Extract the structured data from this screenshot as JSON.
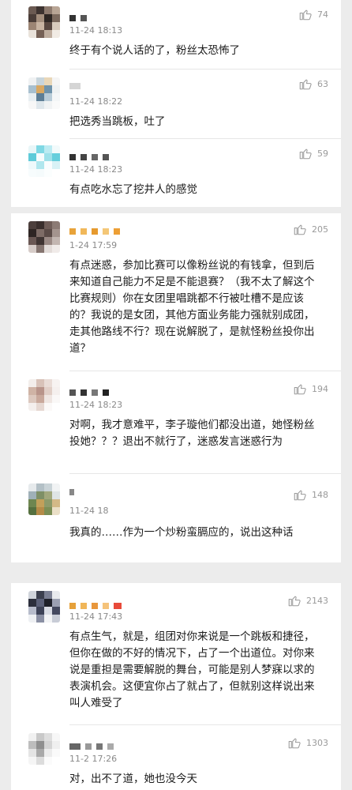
{
  "comments": [
    {
      "time": "11-24 18:13",
      "likes": "74",
      "text": "终于有个说人话的了，粉丝太恐怖了"
    },
    {
      "time": "11-24 18:22",
      "likes": "63",
      "text": "把选秀当跳板，吐了"
    },
    {
      "time": "11-24 18:23",
      "likes": "59",
      "text": "有点吃水忘了挖井人的感觉"
    },
    {
      "time": "1-24 17:59",
      "likes": "205",
      "text": "有点迷惑，参加比赛可以像粉丝说的有钱拿，但到后来知道自己能力不足是不能退赛？（我不太了解这个比赛规则）你在女团里唱跳都不行被吐槽不是应该的？我说的是女团，其他方面业务能力强就别成团，走其他路线不行？现在说解脱了，是就怪粉丝投你出道？"
    },
    {
      "time": "11-24 18:23",
      "likes": "194",
      "text": "对啊，我才意难平，李子璇他们都没出道，她怪粉丝投她？？？退出不就行了，迷惑发言迷惑行为"
    },
    {
      "time": "11-24 18",
      "likes": "148",
      "text": "我真的……作为一个炒粉蛮膈应的，说出这种话"
    },
    {
      "time": "11-24 17:43",
      "likes": "2143",
      "text": "有点生气，就是，组团对你来说是一个跳板和捷径，但你在做的不好的情况下，占了一个出道位。对你来说是重担是需要解脱的舞台，可能是别人梦寐以求的表演机会。这便宜你占了就占了，但就别这样说出来叫人难受了"
    },
    {
      "time": "11-2 17:26",
      "likes": "1303",
      "text": "对，出不了道，她也没今天"
    }
  ]
}
